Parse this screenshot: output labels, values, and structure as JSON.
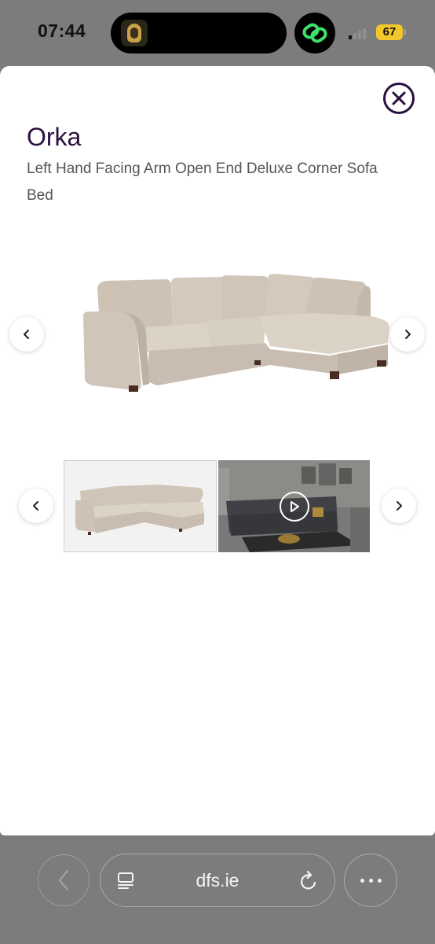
{
  "status_bar": {
    "time": "07:44",
    "battery": "67",
    "colors": {
      "battery": "#f2c72b",
      "link_icon": "#3ee06a"
    }
  },
  "product": {
    "name": "Orka",
    "subtitle": "Left Hand Facing Arm Open End Deluxe Corner Sofa Bed",
    "image": "beige-corner-sofa",
    "thumbnails": [
      {
        "image": "beige-corner-sofa",
        "selected": true
      },
      {
        "image": "grey-sofa-living-room",
        "video": true
      }
    ],
    "colors": {
      "title": "#2a0f3e",
      "sofa": "#d6ccbf"
    }
  },
  "icons": {
    "close": "close-icon",
    "prev": "chevron-left-icon",
    "next": "chevron-right-icon",
    "play": "play-icon",
    "tabs": "tabs-icon",
    "reload": "reload-icon",
    "more": "more-icon"
  },
  "browser": {
    "url": "dfs.ie"
  }
}
